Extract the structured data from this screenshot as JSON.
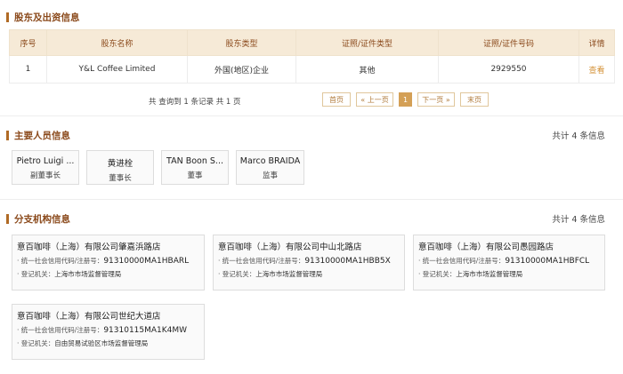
{
  "shareholders": {
    "title": "股东及出资信息",
    "headers": [
      "序号",
      "股东名称",
      "股东类型",
      "证照/证件类型",
      "证照/证件号码",
      "详情"
    ],
    "rows": [
      {
        "index": "1",
        "name": "Y&L Coffee Limited",
        "type": "外国(地区)企业",
        "cert_type": "其他",
        "cert_no": "2929550",
        "detail": "查看"
      }
    ],
    "summary": "共 查询到 1 条记录 共 1 页",
    "pager": {
      "first": "首页",
      "prev": "« 上一页",
      "current": "1",
      "next": "下一页 »",
      "last": "末页"
    }
  },
  "personnel": {
    "title": "主要人员信息",
    "count": "共计 4 条信息",
    "people": [
      {
        "name": "Pietro Luigi ...",
        "role": "副董事长"
      },
      {
        "name": "黄进栓",
        "role": "董事长"
      },
      {
        "name": "TAN Boon S...",
        "role": "董事"
      },
      {
        "name": "Marco BRAIDA",
        "role": "监事"
      }
    ]
  },
  "branches": {
    "title": "分支机构信息",
    "count": "共计 4 条信息",
    "code_label": "统一社会信用代码/注册号：",
    "authority_label": "登记机关：",
    "items": [
      {
        "name": "意百咖啡（上海）有限公司肇嘉浜路店",
        "code": "91310000MA1HBARL",
        "authority": "上海市市场监督管理局"
      },
      {
        "name": "意百咖啡（上海）有限公司中山北路店",
        "code": "91310000MA1HBB5X",
        "authority": "上海市市场监督管理局"
      },
      {
        "name": "意百咖啡（上海）有限公司愚园路店",
        "code": "91310000MA1HBFCL",
        "authority": "上海市市场监督管理局"
      },
      {
        "name": "意百咖啡（上海）有限公司世纪大道店",
        "code": "91310115MA1K4MW",
        "authority": "自由贸易试验区市场监督管理局"
      }
    ]
  }
}
